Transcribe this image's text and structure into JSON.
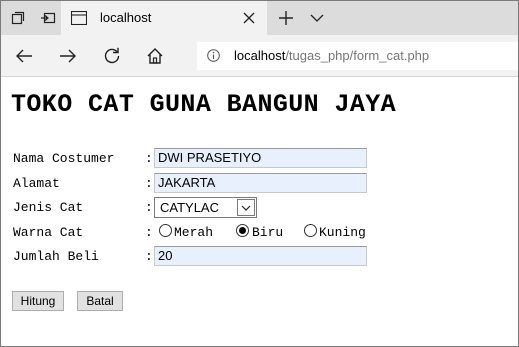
{
  "browser": {
    "tab_title": "localhost",
    "url_host": "localhost",
    "url_path": "/tugas_php/form_cat.php",
    "icons": {
      "tab_actions": "tab-actions-icon",
      "set_aside": "set-aside-tabs-icon",
      "favicon": "page-icon",
      "close": "close-icon",
      "new_tab": "plus-icon",
      "tab_menu": "chevron-down-icon",
      "back": "back-arrow-icon",
      "forward": "forward-arrow-icon",
      "refresh": "refresh-icon",
      "home": "home-icon",
      "info": "info-icon"
    }
  },
  "page": {
    "title": "TOKO CAT GUNA BANGUN JAYA",
    "form": {
      "colon": ":",
      "nama": {
        "label": "Nama Costumer",
        "value": "DWI PRASETIYO"
      },
      "alamat": {
        "label": "Alamat",
        "value": "JAKARTA"
      },
      "jenis": {
        "label": "Jenis Cat",
        "selected": "CATYLAC"
      },
      "warna": {
        "label": "Warna Cat",
        "options": [
          "Merah",
          "Biru",
          "Kuning"
        ],
        "selected": "Biru"
      },
      "jumlah": {
        "label": "Jumlah Beli",
        "value": "20"
      }
    },
    "buttons": {
      "hitung": "Hitung",
      "batal": "Batal"
    }
  }
}
